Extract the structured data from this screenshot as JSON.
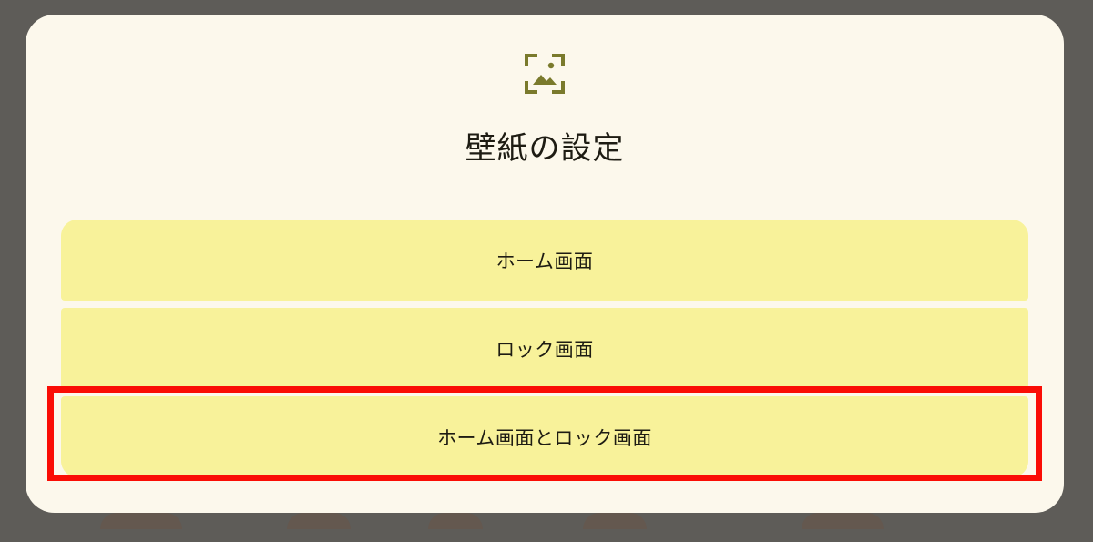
{
  "dialog": {
    "icon": "wallpaper-icon",
    "title": "壁紙の設定",
    "options": [
      {
        "label": "ホーム画面"
      },
      {
        "label": "ロック画面"
      },
      {
        "label": "ホーム画面とロック画面"
      }
    ]
  },
  "colors": {
    "scrim": "#5e5c58",
    "dialog_background": "#fcf8ec",
    "option_background": "#f8f29a",
    "icon_color": "#7a7a2c",
    "text_color": "#1e1c13",
    "highlight": "#fa0d05"
  }
}
